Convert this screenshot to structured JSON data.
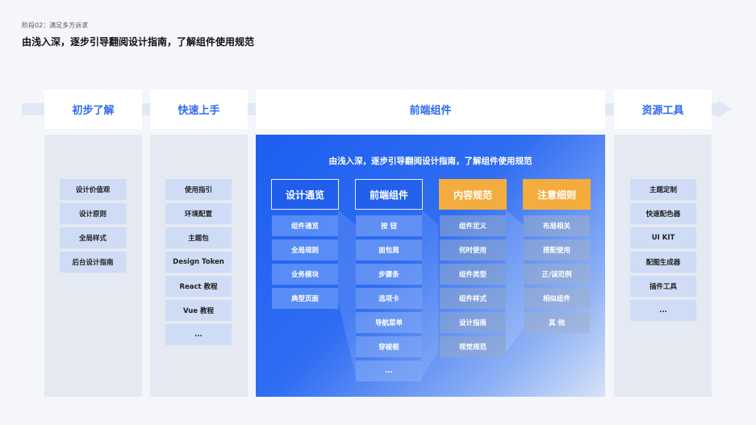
{
  "stage_label": "阶段02：满足多方诉求",
  "headline": "由浅入深，逐步引导翻阅设计指南，了解组件使用规范",
  "columns": [
    {
      "title": "初步了解",
      "items": [
        "设计价值观",
        "设计原则",
        "全局样式",
        "后台设计指南"
      ]
    },
    {
      "title": "快速上手",
      "items": [
        "使用指引",
        "环境配置",
        "主题包",
        "Design Token",
        "React 教程",
        "Vue 教程",
        "..."
      ]
    },
    {
      "title": "前端组件"
    },
    {
      "title": "资源工具",
      "items": [
        "主题定制",
        "快速配色器",
        "UI KIT",
        "配图生成器",
        "插件工具",
        "..."
      ]
    }
  ],
  "panel": {
    "title": "由浅入深，逐步引导翻阅设计指南，了解组件使用规范",
    "groups": [
      {
        "title": "设计通览",
        "items": [
          "组件通览",
          "全局规则",
          "业务模块",
          "典型页面"
        ]
      },
      {
        "title": "前端组件",
        "items": [
          "按 钮",
          "面包屑",
          "步骤条",
          "选项卡",
          "导航菜单",
          "穿梭框",
          "..."
        ]
      },
      {
        "title": "内容规范",
        "items": [
          "组件定义",
          "何时使用",
          "组件类型",
          "组件样式",
          "设计指南",
          "视觉规范"
        ]
      },
      {
        "title": "注意细则",
        "items": [
          "布局相关",
          "搭配使用",
          "正/误范例",
          "相似组件",
          "其 他"
        ]
      }
    ]
  },
  "colors": {
    "accent": "#2e6bf0",
    "orange": "#f3ac3d",
    "item_bg": "#cfdcf5"
  }
}
